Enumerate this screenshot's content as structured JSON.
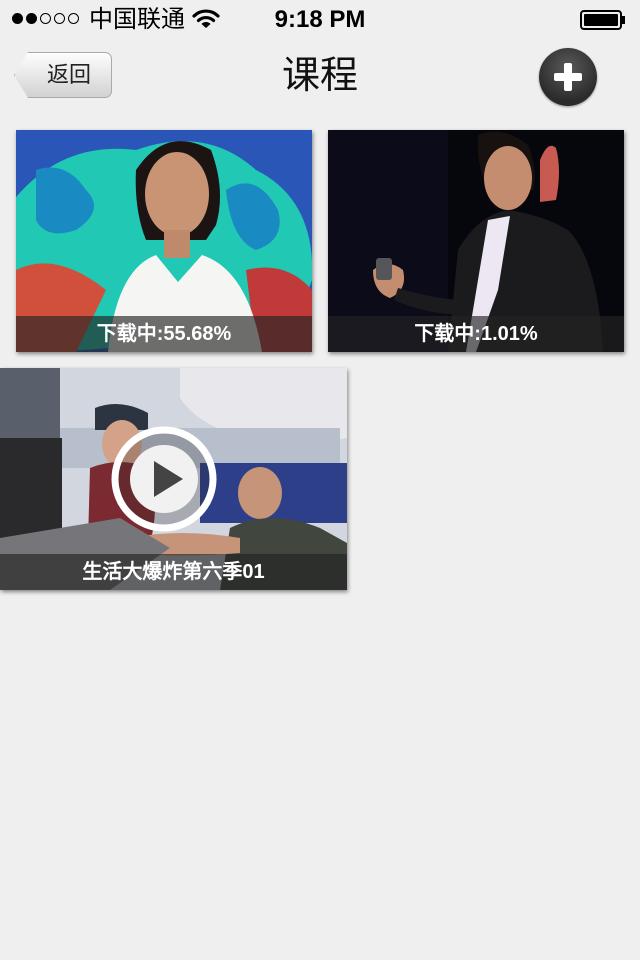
{
  "status_bar": {
    "carrier": "中国联通",
    "time": "9:18 PM"
  },
  "nav": {
    "back_label": "返回",
    "title": "课程"
  },
  "courses": [
    {
      "caption": "下载中:55.68%"
    },
    {
      "caption": "下载中:1.01%"
    },
    {
      "caption": "生活大爆炸第六季01"
    }
  ],
  "colors": {
    "background": "#efefef",
    "caption_overlay": "#232323"
  },
  "icons": [
    "signal-dots-icon",
    "wifi-icon",
    "battery-icon",
    "add-icon",
    "play-icon"
  ]
}
